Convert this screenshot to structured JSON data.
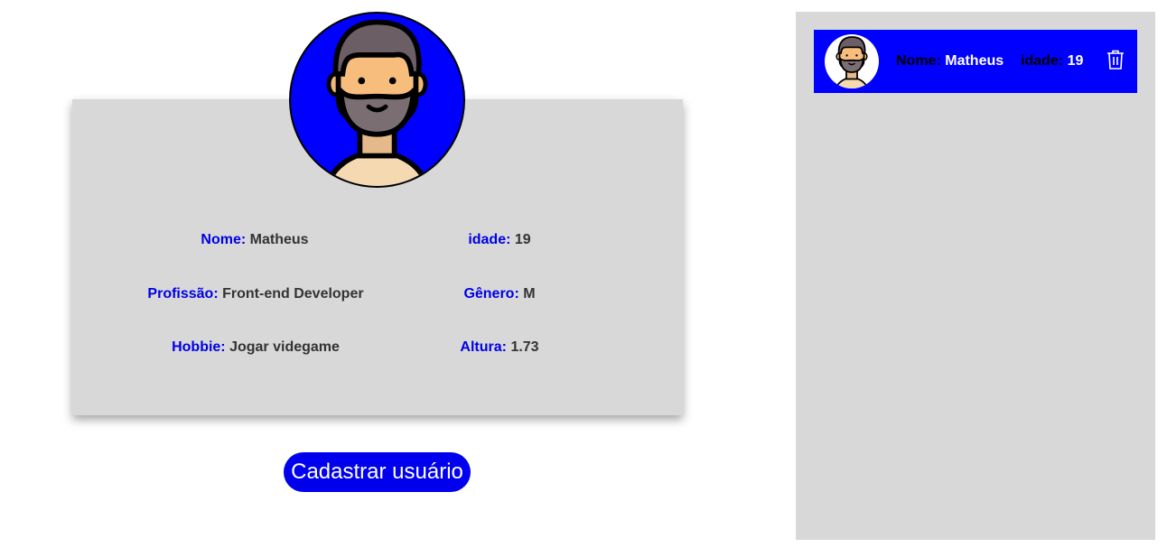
{
  "profile": {
    "name_label": "Nome:",
    "name_value": "Matheus",
    "age_label": "idade:",
    "age_value": "19",
    "profession_label": "Profissão:",
    "profession_value": "Front-end Developer",
    "gender_label": "Gênero:",
    "gender_value": "M",
    "hobby_label": "Hobbie:",
    "hobby_value": "Jogar videgame",
    "height_label": "Altura:",
    "height_value": "1.73",
    "avatar_icon": "bearded-man-avatar-icon"
  },
  "actions": {
    "register_label": "Cadastrar usuário"
  },
  "user_list": {
    "items": [
      {
        "name_label": "Nome:",
        "name_value": "Matheus",
        "age_label": "idade:",
        "age_value": "19",
        "avatar_icon": "bearded-man-avatar-icon",
        "delete_icon": "trash-icon"
      }
    ]
  },
  "colors": {
    "accent": "#0000ff",
    "card_bg": "#d8d8d8",
    "label_blue": "#0000e6",
    "value_text": "#333333"
  }
}
